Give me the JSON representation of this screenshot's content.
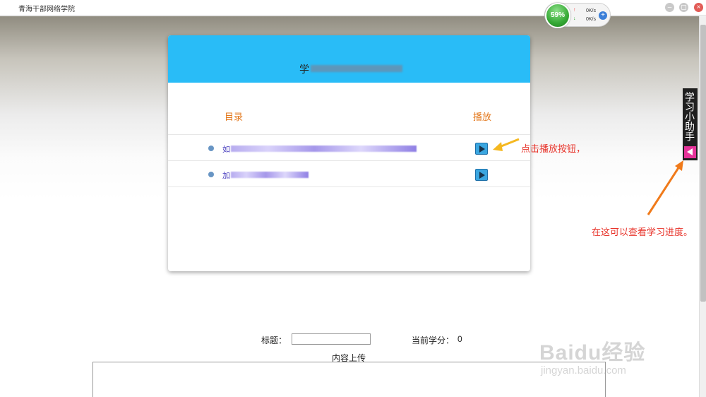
{
  "window": {
    "title": "青海干部网络学院",
    "minimize_label": "–",
    "maximize_label": "◻",
    "close_label": "×"
  },
  "speed_widget": {
    "percent": "59%",
    "upload": "0K/s",
    "download": "0K/s",
    "up_arrow": "↑",
    "down_arrow": "↓",
    "plus": "+"
  },
  "dialog": {
    "title_prefix": "学",
    "header_color": "#29bcf7",
    "columns": {
      "catalog": "目录",
      "play": "播放"
    },
    "rows": [
      {
        "title_prefix": "如",
        "action": "play-icon"
      },
      {
        "title_prefix": "加",
        "action": "play-icon"
      }
    ]
  },
  "annotations": {
    "play_hint": "点击播放按钮，",
    "progress_hint": "在这可以查看学习进度。",
    "arrow_color_1": "#f5b820",
    "arrow_color_2": "#f07a1a"
  },
  "helper": {
    "label": "学习小助手",
    "toggle_icon": "left-triangle-icon"
  },
  "form": {
    "title_label": "标题：",
    "title_value": "",
    "credit_label": "当前学分：",
    "credit_value": "0",
    "upload_label": "内容上传"
  },
  "watermark": {
    "text": "Baidu经验",
    "url": "jingyan.baidu.com"
  }
}
